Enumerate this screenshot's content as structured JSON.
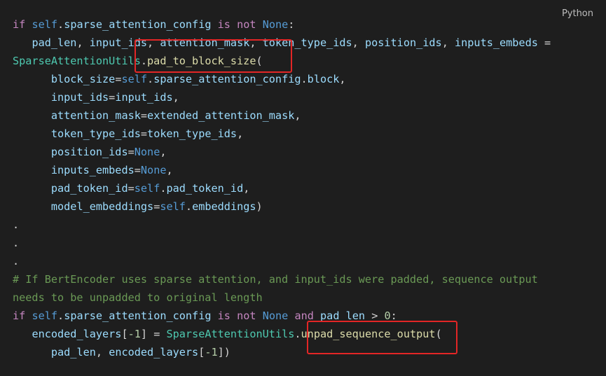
{
  "language_label": "Python",
  "colors": {
    "keyword": "#c586c0",
    "identifier": "#9cdcfe",
    "self": "#569cd6",
    "constant": "#569cd6",
    "class": "#4ec9b0",
    "function": "#dcdcaa",
    "operator": "#d4d4d4",
    "number": "#b5cea8",
    "comment": "#6a9955",
    "default": "#d4d4d4"
  },
  "lines": [
    [
      [
        "if",
        "keyword"
      ],
      [
        " ",
        "default"
      ],
      [
        "self",
        "self"
      ],
      [
        ".",
        "default"
      ],
      [
        "sparse_attention_config",
        "identifier"
      ],
      [
        " ",
        "default"
      ],
      [
        "is",
        "keyword"
      ],
      [
        " ",
        "default"
      ],
      [
        "not",
        "keyword"
      ],
      [
        " ",
        "default"
      ],
      [
        "None",
        "constant"
      ],
      [
        ":",
        "default"
      ]
    ],
    [
      [
        "   ",
        "default"
      ],
      [
        "pad_len",
        "identifier"
      ],
      [
        ", ",
        "default"
      ],
      [
        "input_ids",
        "identifier"
      ],
      [
        ", ",
        "default"
      ],
      [
        "attention_mask",
        "identifier"
      ],
      [
        ", ",
        "default"
      ],
      [
        "token_type_ids",
        "identifier"
      ],
      [
        ", ",
        "default"
      ],
      [
        "position_ids",
        "identifier"
      ],
      [
        ", ",
        "default"
      ],
      [
        "inputs_embeds",
        "identifier"
      ],
      [
        " = ",
        "operator"
      ]
    ],
    [
      [
        "SparseAttentionUtils",
        "class"
      ],
      [
        ".",
        "default"
      ],
      [
        "pad_to_block_size",
        "function"
      ],
      [
        "(",
        "default"
      ]
    ],
    [
      [
        "      ",
        "default"
      ],
      [
        "block_size",
        "identifier"
      ],
      [
        "=",
        "operator"
      ],
      [
        "self",
        "self"
      ],
      [
        ".",
        "default"
      ],
      [
        "sparse_attention_config",
        "identifier"
      ],
      [
        ".",
        "default"
      ],
      [
        "block",
        "identifier"
      ],
      [
        ",",
        "default"
      ]
    ],
    [
      [
        "      ",
        "default"
      ],
      [
        "input_ids",
        "identifier"
      ],
      [
        "=",
        "operator"
      ],
      [
        "input_ids",
        "identifier"
      ],
      [
        ",",
        "default"
      ]
    ],
    [
      [
        "      ",
        "default"
      ],
      [
        "attention_mask",
        "identifier"
      ],
      [
        "=",
        "operator"
      ],
      [
        "extended_attention_mask",
        "identifier"
      ],
      [
        ",",
        "default"
      ]
    ],
    [
      [
        "      ",
        "default"
      ],
      [
        "token_type_ids",
        "identifier"
      ],
      [
        "=",
        "operator"
      ],
      [
        "token_type_ids",
        "identifier"
      ],
      [
        ",",
        "default"
      ]
    ],
    [
      [
        "      ",
        "default"
      ],
      [
        "position_ids",
        "identifier"
      ],
      [
        "=",
        "operator"
      ],
      [
        "None",
        "constant"
      ],
      [
        ",",
        "default"
      ]
    ],
    [
      [
        "      ",
        "default"
      ],
      [
        "inputs_embeds",
        "identifier"
      ],
      [
        "=",
        "operator"
      ],
      [
        "None",
        "constant"
      ],
      [
        ",",
        "default"
      ]
    ],
    [
      [
        "      ",
        "default"
      ],
      [
        "pad_token_id",
        "identifier"
      ],
      [
        "=",
        "operator"
      ],
      [
        "self",
        "self"
      ],
      [
        ".",
        "default"
      ],
      [
        "pad_token_id",
        "identifier"
      ],
      [
        ",",
        "default"
      ]
    ],
    [
      [
        "      ",
        "default"
      ],
      [
        "model_embeddings",
        "identifier"
      ],
      [
        "=",
        "operator"
      ],
      [
        "self",
        "self"
      ],
      [
        ".",
        "default"
      ],
      [
        "embeddings",
        "identifier"
      ],
      [
        ")",
        "default"
      ]
    ],
    [
      [
        ".",
        "default"
      ]
    ],
    [
      [
        ".",
        "default"
      ]
    ],
    [
      [
        ".",
        "default"
      ]
    ],
    [
      [
        "# If BertEncoder uses sparse attention, and input_ids were padded, sequence output",
        "comment"
      ]
    ],
    [
      [
        "needs to be unpadded to original length",
        "comment"
      ]
    ],
    [
      [
        "if",
        "keyword"
      ],
      [
        " ",
        "default"
      ],
      [
        "self",
        "self"
      ],
      [
        ".",
        "default"
      ],
      [
        "sparse_attention_config",
        "identifier"
      ],
      [
        " ",
        "default"
      ],
      [
        "is",
        "keyword"
      ],
      [
        " ",
        "default"
      ],
      [
        "not",
        "keyword"
      ],
      [
        " ",
        "default"
      ],
      [
        "None",
        "constant"
      ],
      [
        " ",
        "default"
      ],
      [
        "and",
        "keyword"
      ],
      [
        " ",
        "default"
      ],
      [
        "pad_len",
        "identifier"
      ],
      [
        " > ",
        "operator"
      ],
      [
        "0",
        "number"
      ],
      [
        ":",
        "default"
      ]
    ],
    [
      [
        "   ",
        "default"
      ],
      [
        "encoded_layers",
        "identifier"
      ],
      [
        "[",
        "default"
      ],
      [
        "-1",
        "number"
      ],
      [
        "]",
        "default"
      ],
      [
        " = ",
        "operator"
      ],
      [
        "SparseAttentionUtils",
        "class"
      ],
      [
        ".",
        "default"
      ],
      [
        "unpad_sequence_output",
        "function"
      ],
      [
        "(",
        "default"
      ]
    ],
    [
      [
        "      ",
        "default"
      ],
      [
        "pad_len",
        "identifier"
      ],
      [
        ", ",
        "default"
      ],
      [
        "encoded_layers",
        "identifier"
      ],
      [
        "[",
        "default"
      ],
      [
        "-1",
        "number"
      ],
      [
        "])",
        "default"
      ]
    ]
  ]
}
